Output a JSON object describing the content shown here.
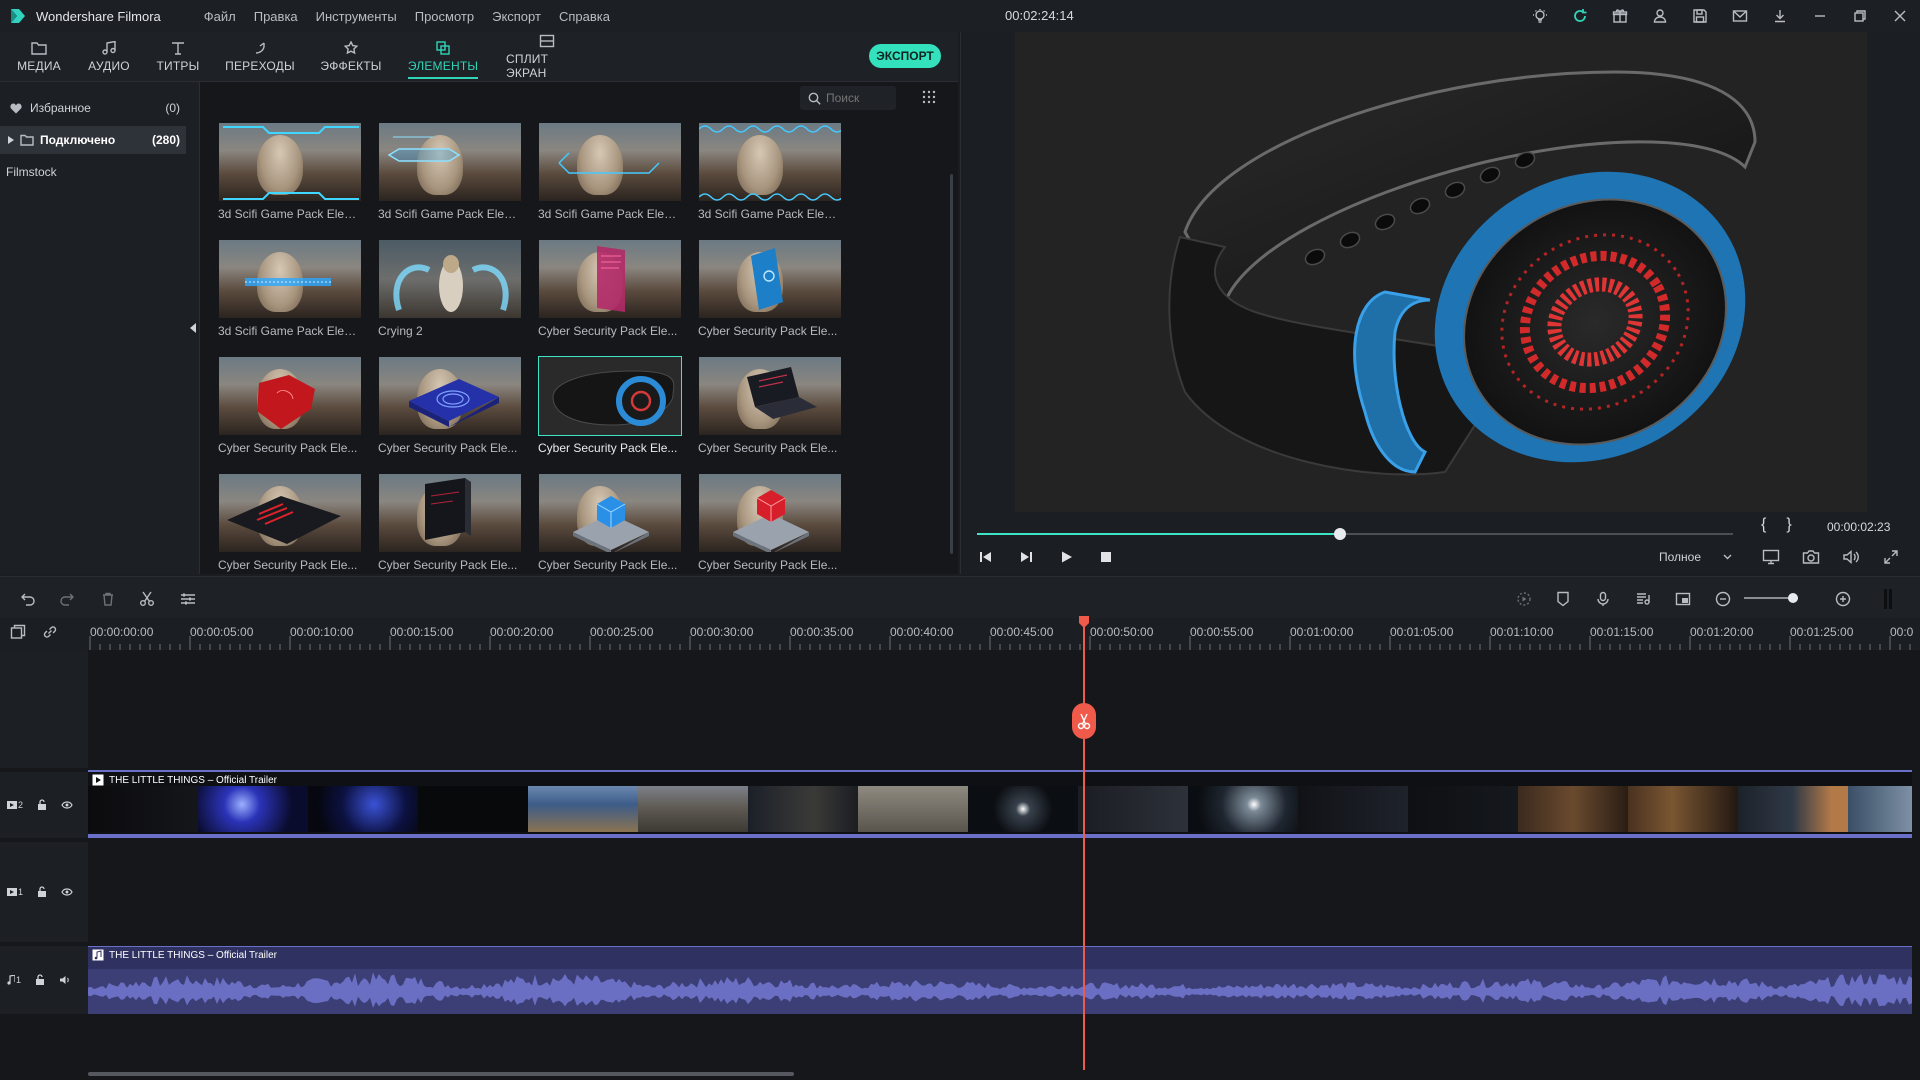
{
  "window": {
    "app_name": "Wondershare Filmora",
    "timecode": "00:02:24:14",
    "menu": [
      "Файл",
      "Правка",
      "Инструменты",
      "Просмотр",
      "Экспорт",
      "Справка"
    ],
    "tool_icons": [
      "lightbulb-icon",
      "refresh-icon",
      "gift-icon",
      "user-icon",
      "save-icon",
      "mail-icon",
      "download-icon"
    ]
  },
  "tabs": [
    {
      "label": "МЕДИА",
      "icon": "folder-icon"
    },
    {
      "label": "АУДИО",
      "icon": "music-icon"
    },
    {
      "label": "ТИТРЫ",
      "icon": "text-icon"
    },
    {
      "label": "ПЕРЕХОДЫ",
      "icon": "transition-icon"
    },
    {
      "label": "ЭФФЕКТЫ",
      "icon": "effects-icon"
    },
    {
      "label": "ЭЛЕМЕНТЫ",
      "icon": "elements-icon",
      "active": true
    },
    {
      "label": "СПЛИТ ЭКРАН",
      "icon": "split-screen-icon"
    }
  ],
  "export_label": "ЭКСПОРТ",
  "library": {
    "favorites": {
      "label": "Избранное",
      "count": "(0)"
    },
    "connected": {
      "label": "Подключено",
      "count": "(280)"
    },
    "filmstock": "Filmstock"
  },
  "search": {
    "placeholder": "Поиск"
  },
  "elements": [
    {
      "caption": "3d Scifi Game Pack Elem...",
      "kind": "scifi-frame"
    },
    {
      "caption": "3d Scifi Game Pack Elem...",
      "kind": "scifi-badge"
    },
    {
      "caption": "3d Scifi Game Pack Elem...",
      "kind": "scifi-bracket"
    },
    {
      "caption": "3d Scifi Game Pack Elem...",
      "kind": "scifi-wave"
    },
    {
      "caption": "3d Scifi Game Pack Elem...",
      "kind": "scifi-bar"
    },
    {
      "caption": "Crying 2",
      "kind": "crying"
    },
    {
      "caption": "Cyber Security Pack Ele...",
      "kind": "pink-card"
    },
    {
      "caption": "Cyber Security Pack Ele...",
      "kind": "blue-phone"
    },
    {
      "caption": "Cyber Security Pack Ele...",
      "kind": "red-shield"
    },
    {
      "caption": "Cyber Security Pack Ele...",
      "kind": "fingerprint"
    },
    {
      "caption": "Cyber Security Pack Ele...",
      "kind": "smartwatch",
      "selected": true
    },
    {
      "caption": "Cyber Security Pack Ele...",
      "kind": "laptop"
    },
    {
      "caption": "Cyber Security Pack Ele...",
      "kind": "red-tablet"
    },
    {
      "caption": "Cyber Security Pack Ele...",
      "kind": "dark-screen"
    },
    {
      "caption": "Cyber Security Pack Ele...",
      "kind": "blue-cube"
    },
    {
      "caption": "Cyber Security Pack Ele...",
      "kind": "red-cube"
    }
  ],
  "preview": {
    "time": "00:00:02:23",
    "progress": 0.48,
    "brackets": [
      "{",
      "}"
    ],
    "quality": "Полное"
  },
  "ruler": {
    "labels": [
      "00:00:00:00",
      "00:00:05:00",
      "00:00:10:00",
      "00:00:15:00",
      "00:00:20:00",
      "00:00:25:00",
      "00:00:30:00",
      "00:00:35:00",
      "00:00:40:00",
      "00:00:45:00",
      "00:00:50:00",
      "00:00:55:00",
      "00:01:00:00",
      "00:01:05:00",
      "00:01:10:00",
      "00:01:15:00",
      "00:01:20:00",
      "00:01:25:00",
      "00:0"
    ]
  },
  "tracks": {
    "video2": {
      "label": "2",
      "clip_title": "THE LITTLE THINGS – Official Trailer"
    },
    "video1": {
      "label": "1"
    },
    "audio1": {
      "label": "1",
      "clip_title": "THE LITTLE THINGS – Official Trailer"
    }
  },
  "colors": {
    "accent": "#32d4b7",
    "playhead": "#f05a4a",
    "clip_border": "#6a6fc8",
    "audio_wave": "#6b6fc4"
  }
}
